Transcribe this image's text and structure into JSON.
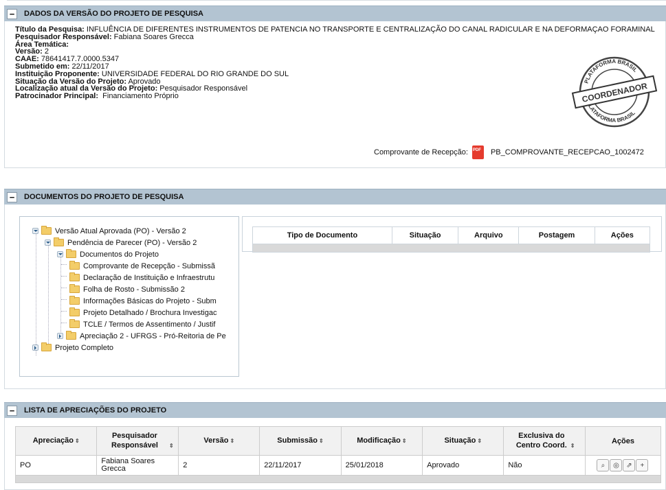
{
  "panels": {
    "p1_title": "DADOS DA VERSÃO DO PROJETO DE PESQUISA",
    "p2_title": "DOCUMENTOS DO PROJETO DE PESQUISA",
    "p3_title": "LISTA DE APRECIAÇÕES DO PROJETO",
    "collapse_glyph": "−"
  },
  "project": {
    "titulo_label": "Título da Pesquisa:",
    "titulo_value": "INFLUÊNCIA DE DIFERENTES INSTRUMENTOS DE PATENCIA NO TRANSPORTE E CENTRALIZAÇÃO DO CANAL RADICULAR E NA DEFORMAÇAO FORAMINAL",
    "pesquisador_label": "Pesquisador Responsável:",
    "pesquisador_value": "Fabiana Soares Grecca",
    "area_label": "Área Temática:",
    "area_value": "",
    "versao_label": "Versão:",
    "versao_value": "2",
    "caae_label": "CAAE:",
    "caae_value": "78641417.7.0000.5347",
    "submetido_label": "Submetido em:",
    "submetido_value": "22/11/2017",
    "instituicao_label": "Instituição Proponente:",
    "instituicao_value": "UNIVERSIDADE FEDERAL DO RIO GRANDE DO SUL",
    "situacao_label": "Situação da Versão do Projeto:",
    "situacao_value": "Aprovado",
    "localizacao_label": "Localização atual da Versão do Projeto:",
    "localizacao_value": "Pesquisador Responsável",
    "patrocinador_label": "Patrocinador Principal:",
    "patrocinador_value": "Financiamento Próprio",
    "stamp_top": "PLATAFORMA BRASIL",
    "stamp_center": "COORDENADOR",
    "stamp_bottom": "PLATAFORMA BRASIL",
    "receipt_label": "Comprovante de Recepção:",
    "receipt_file": "PB_COMPROVANTE_RECEPCAO_1002472",
    "pdf_text": "PDF"
  },
  "tree": [
    {
      "label": "Versão Atual Aprovada (PO) - Versão 2"
    },
    {
      "label": "Pendência de Parecer (PO) - Versão 2"
    },
    {
      "label": "Documentos do Projeto"
    },
    {
      "label": "Comprovante de Recepção - Submissã"
    },
    {
      "label": "Declaração de Instituição e Infraestrutu"
    },
    {
      "label": "Folha de Rosto - Submissão 2"
    },
    {
      "label": "Informações Básicas do Projeto - Subm"
    },
    {
      "label": "Projeto Detalhado / Brochura Investigac"
    },
    {
      "label": "TCLE / Termos de Assentimento / Justif"
    },
    {
      "label": "Apreciação 2 - UFRGS - Pró-Reitoria de Pe"
    },
    {
      "label": "Projeto Completo"
    }
  ],
  "doc_table": {
    "headers": [
      "Tipo de Documento",
      "Situação",
      "Arquivo",
      "Postagem",
      "Ações"
    ]
  },
  "apreciacoes": {
    "headers": [
      "Apreciação",
      "Pesquisador Responsável",
      "Versão",
      "Submissão",
      "Modificação",
      "Situação",
      "Exclusiva do Centro Coord.",
      "Ações"
    ],
    "sort_glyph": "⇕",
    "rows": [
      [
        "PO",
        "Fabiana Soares Grecca",
        "2",
        "22/11/2017",
        "25/01/2018",
        "Aprovado",
        "Não"
      ]
    ],
    "actions": [
      "⌕",
      "◎",
      "⇗",
      "+"
    ]
  }
}
